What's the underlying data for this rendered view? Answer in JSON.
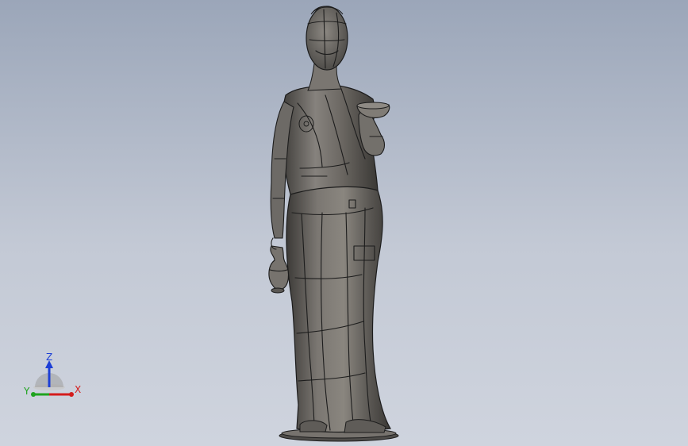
{
  "colors": {
    "background_top": "#9ba6b9",
    "background_bottom": "#cfd4de",
    "model_surface": "#6d6a66",
    "model_edges": "#1c1c1c",
    "axis_x": "#d41c1c",
    "axis_y": "#1fa31f",
    "axis_z": "#1d3fd6"
  },
  "triad": {
    "x_label": "X",
    "y_label": "Y",
    "z_label": "Z"
  },
  "icons": {
    "model": "statue-model",
    "triad": "axis-triad-icon"
  }
}
